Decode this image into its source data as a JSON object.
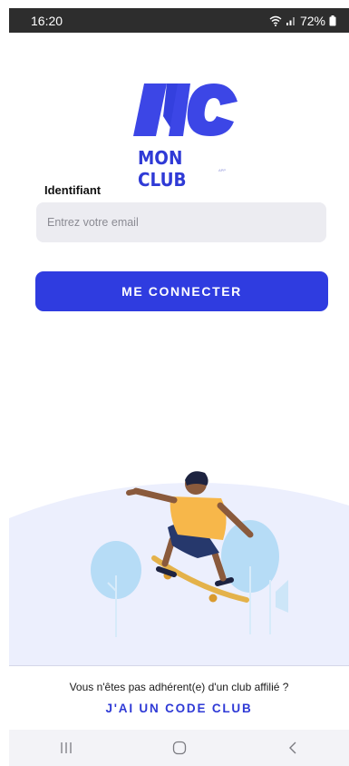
{
  "status_bar": {
    "time": "16:20",
    "battery": "72%",
    "icons": [
      "wifi-icon",
      "signal-icon",
      "battery-icon"
    ]
  },
  "logo": {
    "text": "MON CLUB",
    "small_text": "APP",
    "brand_color": "#2f3ad6"
  },
  "login_form": {
    "identifier_label": "Identifiant",
    "email_placeholder": "Entrez votre email",
    "email_value": "",
    "submit_label": "ME CONNECTER"
  },
  "footer": {
    "not_member_text": "Vous n'êtes pas adhérent(e) d'un club affilié ?",
    "code_club_label": "J'AI UN CODE CLUB"
  },
  "nav_bar": {
    "icons": [
      "recent-apps-icon",
      "home-icon",
      "back-icon"
    ]
  },
  "colors": {
    "primary": "#2f3ce0",
    "input_bg": "#ececf1",
    "illustration_bg": "#eceffd"
  }
}
